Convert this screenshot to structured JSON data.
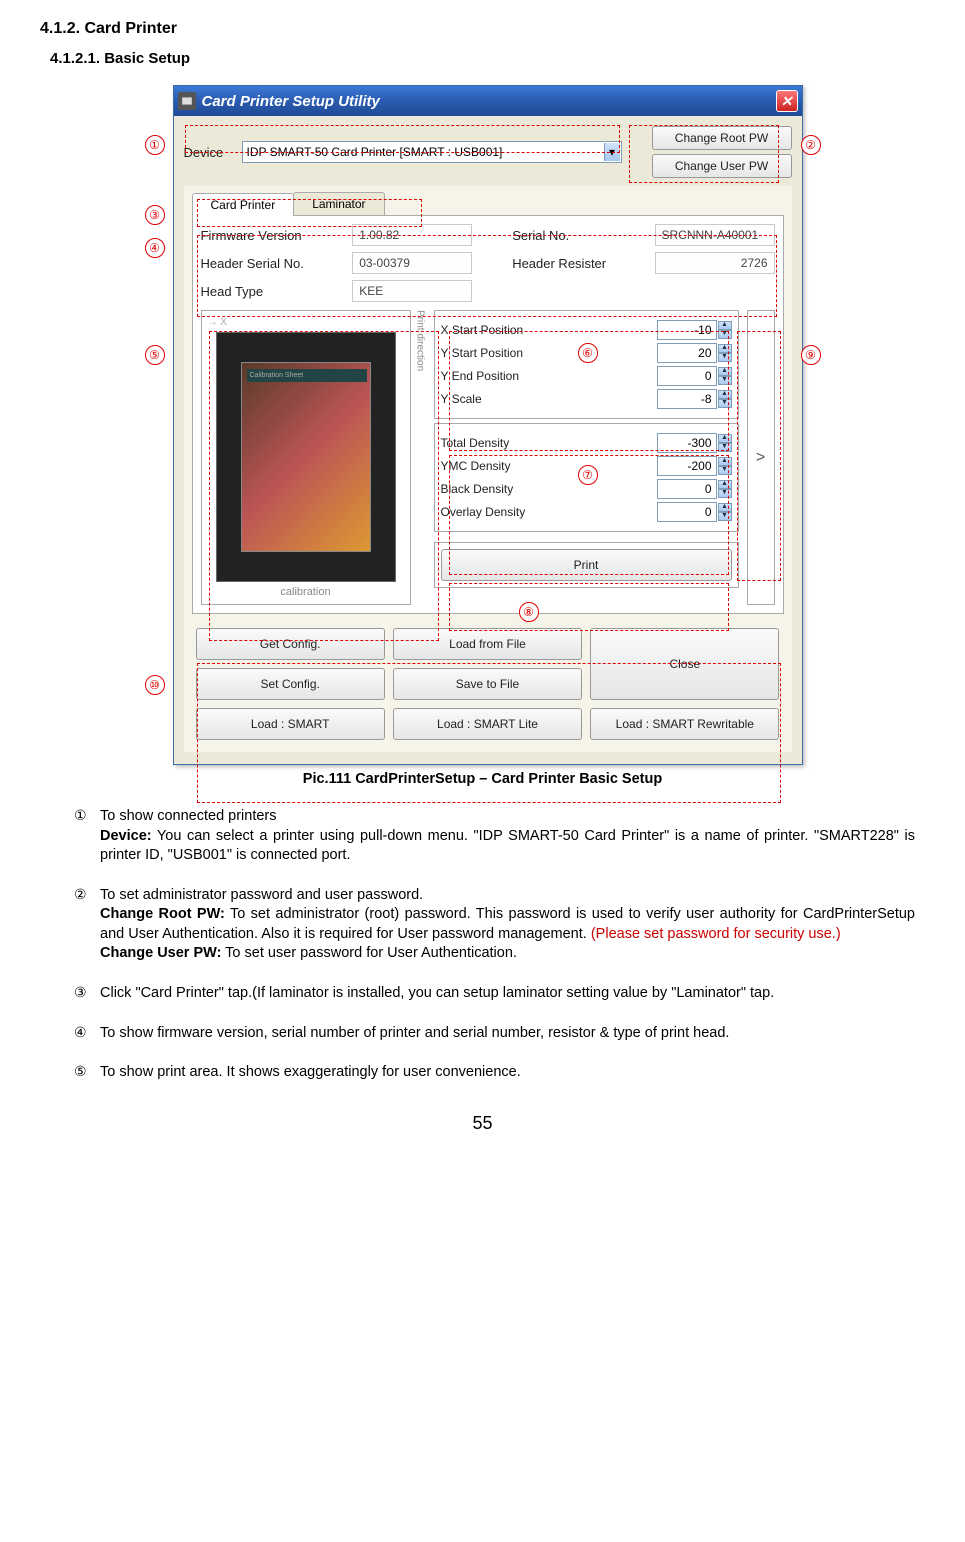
{
  "headings": {
    "section": "4.1.2. Card Printer",
    "subsection": "4.1.2.1. Basic Setup"
  },
  "callouts": {
    "c1": "①",
    "c2": "②",
    "c3": "③",
    "c4": "④",
    "c5": "⑤",
    "c6": "⑥",
    "c7": "⑦",
    "c8": "⑧",
    "c9": "⑨",
    "c10": "⑩"
  },
  "window": {
    "title": "Card Printer Setup Utility",
    "device_label": "Device",
    "device_value": "IDP SMART-50 Card Printer  [SMART : USB001]",
    "change_root_btn": "Change Root PW",
    "change_user_btn": "Change User PW",
    "tabs": {
      "card_printer": "Card Printer",
      "laminator": "Laminator"
    },
    "info": {
      "fw_label": "Firmware Version",
      "fw_value": "1.00.82",
      "sn_label": "Serial No.",
      "sn_value": "SRCNNN-A40001",
      "hsn_label": "Header Serial No.",
      "hsn_value": "03-00379",
      "hr_label": "Header Resister",
      "hr_value": "2726",
      "ht_label": "Head Type",
      "ht_value": "KEE"
    },
    "preview": {
      "print_direction": "Print direction",
      "calibration_text": "Calibration Sheet",
      "label": "calibration",
      "arrow_x": "→ X"
    },
    "spinners1": {
      "x_start": {
        "label": "X Start Position",
        "value": "-10"
      },
      "y_start": {
        "label": "Y Start Position",
        "value": "20"
      },
      "y_end": {
        "label": "Y End Position",
        "value": "0"
      },
      "y_scale": {
        "label": "Y Scale",
        "value": "-8"
      }
    },
    "spinners2": {
      "total_density": {
        "label": "Total Density",
        "value": "-300"
      },
      "ymc_density": {
        "label": "YMC Density",
        "value": "-200"
      },
      "black_density": {
        "label": "Black Density",
        "value": "0"
      },
      "overlay_density": {
        "label": "Overlay Density",
        "value": "0"
      }
    },
    "print_btn": "Print",
    "expand_btn": ">",
    "bottom": {
      "get_config": "Get Config.",
      "load_file": "Load from File",
      "close": "Close",
      "set_config": "Set Config.",
      "save_file": "Save to File",
      "load_smart": "Load : SMART",
      "load_smart_lite": "Load : SMART Lite",
      "load_smart_rw": "Load : SMART Rewritable"
    }
  },
  "caption": "Pic.111    CardPrinterSetup – Card Printer Basic Setup",
  "descriptions": {
    "d1": {
      "num": "①",
      "line1": "To show connected printers",
      "bold1": "Device:",
      "rest1": " You can select a printer using pull-down menu. \"IDP SMART-50 Card Printer\" is a name of printer. \"SMART228\" is printer ID, \"USB001\" is connected port."
    },
    "d2": {
      "num": "②",
      "line1": "To set administrator password and user password.",
      "bold1": "Change Root PW:",
      "rest1": " To set administrator (root) password. This password is used to verify user authority for CardPrinterSetup and User Authentication. Also it is required for User password management. ",
      "red1": "(Please set password for security use.)",
      "bold2": "Change User PW:",
      "rest2": " To set user password for User Authentication."
    },
    "d3": {
      "num": "③",
      "text": "Click \"Card Printer\" tap.(If laminator is installed, you can setup laminator setting value by \"Laminator\" tap."
    },
    "d4": {
      "num": "④",
      "text": "To show firmware version, serial number of printer and serial number, resistor & type of print head."
    },
    "d5": {
      "num": "⑤",
      "text_a": "To show print area. It shows ",
      "text_b": "exaggeratingly",
      "text_c": " for user convenience."
    }
  },
  "page_number": "55"
}
